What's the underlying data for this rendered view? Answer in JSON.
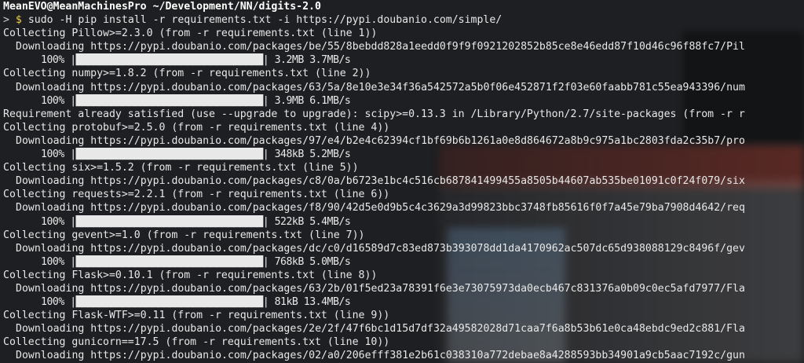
{
  "title_bar": {
    "user_host": "MeanEVO@MeanMachinesPro",
    "path": " ~/Development/NN/digits-2.0"
  },
  "prompt": {
    "arrow": ">",
    "dollar": "$",
    "command": "sudo -H pip install -r requirements.txt -i https://pypi.doubanio.com/simple/"
  },
  "output_lines": [
    {
      "indent": 0,
      "text": "Collecting Pillow>=2.3.0 (from -r requirements.txt (line 1))"
    },
    {
      "indent": 1,
      "text": "Downloading https://pypi.doubanio.com/packages/be/55/8bebdd828a1eedd0f9f9f0921202852b85ce8e46edd87f10d46c96f88fc7/Pil"
    },
    {
      "indent": 2,
      "text": "100% |████████████████████████████████| 3.2MB 3.7MB/s"
    },
    {
      "indent": 0,
      "text": "Collecting numpy>=1.8.2 (from -r requirements.txt (line 2))"
    },
    {
      "indent": 1,
      "text": "Downloading https://pypi.doubanio.com/packages/63/5a/8e10e3e34f36a542572a5b0f06e452871f2f03e60faabb781c55ea943396/num"
    },
    {
      "indent": 2,
      "text": "100% |████████████████████████████████| 3.9MB 6.1MB/s"
    },
    {
      "indent": 0,
      "text": "Requirement already satisfied (use --upgrade to upgrade): scipy>=0.13.3 in /Library/Python/2.7/site-packages (from -r r"
    },
    {
      "indent": 0,
      "text": "Collecting protobuf>=2.5.0 (from -r requirements.txt (line 4))"
    },
    {
      "indent": 1,
      "text": "Downloading https://pypi.doubanio.com/packages/97/e4/b2e4c62394cf1bf69b6b1261a0e8d864672a8b9c975a1bc2803fda2c35b7/pro"
    },
    {
      "indent": 2,
      "text": "100% |████████████████████████████████| 348kB 5.2MB/s"
    },
    {
      "indent": 0,
      "text": "Collecting six>=1.5.2 (from -r requirements.txt (line 5))"
    },
    {
      "indent": 1,
      "text": "Downloading https://pypi.doubanio.com/packages/c8/0a/b6723e1bc4c516cb687841499455a8505b44607ab535be01091c0f24f079/six"
    },
    {
      "indent": 0,
      "text": "Collecting requests>=2.2.1 (from -r requirements.txt (line 6))"
    },
    {
      "indent": 1,
      "text": "Downloading https://pypi.doubanio.com/packages/f8/90/42d5e0d9b5c4c3629a3d99823bbc3748fb85616f0f7a45e79ba7908d4642/req"
    },
    {
      "indent": 2,
      "text": "100% |████████████████████████████████| 522kB 5.4MB/s"
    },
    {
      "indent": 0,
      "text": "Collecting gevent>=1.0 (from -r requirements.txt (line 7))"
    },
    {
      "indent": 1,
      "text": "Downloading https://pypi.doubanio.com/packages/dc/c0/d16589d7c83ed873b393078dd1da4170962ac507dc65d938088129c8496f/gev"
    },
    {
      "indent": 2,
      "text": "100% |████████████████████████████████| 768kB 5.0MB/s"
    },
    {
      "indent": 0,
      "text": "Collecting Flask>=0.10.1 (from -r requirements.txt (line 8))"
    },
    {
      "indent": 1,
      "text": "Downloading https://pypi.doubanio.com/packages/63/2b/01f5ed23a78391f6e3e73075973da0ecb467c831376a0b09c0ec5afd7977/Fla"
    },
    {
      "indent": 2,
      "text": "100% |████████████████████████████████| 81kB 13.4MB/s"
    },
    {
      "indent": 0,
      "text": "Collecting Flask-WTF>=0.11 (from -r requirements.txt (line 9))"
    },
    {
      "indent": 1,
      "text": "Downloading https://pypi.doubanio.com/packages/2e/2f/47f6bc1d15d7df32a49582028d71caa7f6a8b53b61e0ca48ebdc9ed2c881/Fla"
    },
    {
      "indent": 0,
      "text": "Collecting gunicorn==17.5 (from -r requirements.txt (line 10))"
    },
    {
      "indent": 1,
      "text": "Downloading https://pypi.doubanio.com/packages/02/a0/206efff381e2b61c038310a772debae8a4288593bb34901a9cb5aac7192c/gun"
    }
  ],
  "colors": {
    "background": "#1e1f22",
    "text": "#e8e8e8",
    "dollar": "#f2d24b"
  }
}
